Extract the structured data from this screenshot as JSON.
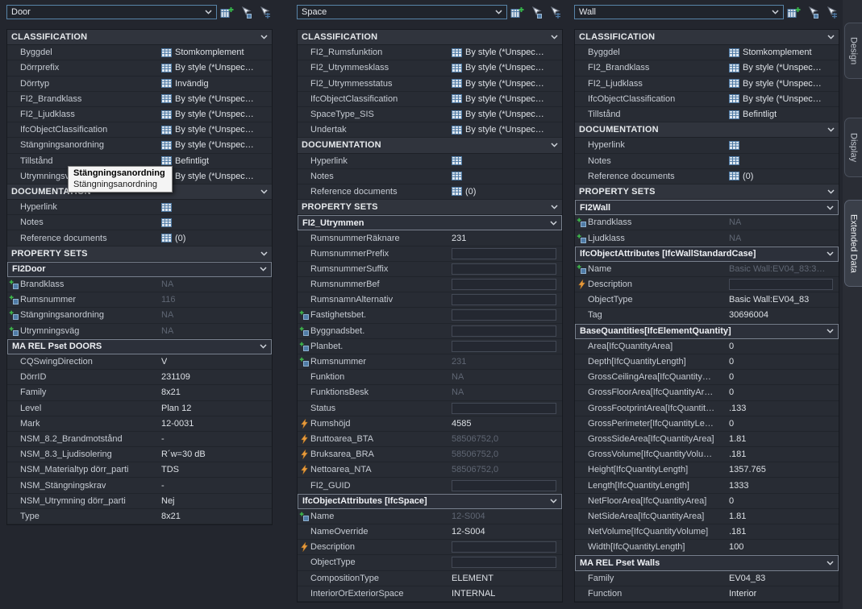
{
  "toolbar": {
    "icons": [
      "add-property-sets-icon",
      "quick-select-icon",
      "select-objects-icon"
    ]
  },
  "tooltip": {
    "title": "Stängningsanordning",
    "body": "Stängningsanordning"
  },
  "tabs": [
    {
      "label": "Design",
      "active": false
    },
    {
      "label": "Display",
      "active": false
    },
    {
      "label": "Extended Data",
      "active": true
    }
  ],
  "palettes": [
    {
      "selector": "Door",
      "blocks": [
        {
          "kind": "category",
          "title": "CLASSIFICATION",
          "rows": [
            {
              "label": "Byggdel",
              "value": "Stomkomplement",
              "value_icon": "table-icon"
            },
            {
              "label": "Dörrprefix",
              "value": "By style (*Unspec…",
              "value_icon": "table-icon"
            },
            {
              "label": "Dörrtyp",
              "value": "Invändig",
              "value_icon": "table-icon"
            },
            {
              "label": "FI2_Brandklass",
              "value": "By style (*Unspec…",
              "value_icon": "table-icon"
            },
            {
              "label": "FI2_Ljudklass",
              "value": "By style (*Unspec…",
              "value_icon": "table-icon"
            },
            {
              "label": "IfcObjectClassification",
              "value": "By style (*Unspec…",
              "value_icon": "table-icon"
            },
            {
              "label": "Stängningsanordning",
              "value": "By style (*Unspec…",
              "value_icon": "table-icon"
            },
            {
              "label": "Tillstånd",
              "value": "Befintligt",
              "value_icon": "table-icon"
            },
            {
              "label": "Utrymningsväg",
              "value": "By style (*Unspec…",
              "value_icon": "table-icon"
            }
          ]
        },
        {
          "kind": "category",
          "title": "DOCUMENTATION",
          "rows": [
            {
              "label": "Hyperlink",
              "value": "",
              "value_icon": "table-icon"
            },
            {
              "label": "Notes",
              "value": "",
              "value_icon": "table-icon"
            },
            {
              "label": "Reference documents",
              "value": "(0)",
              "value_icon": "table-icon"
            }
          ]
        },
        {
          "kind": "category",
          "title": "PROPERTY SETS",
          "rows": []
        },
        {
          "kind": "group",
          "title": "FI2Door",
          "rows": [
            {
              "label": "Brandklass",
              "value": "NA",
              "muted": true,
              "left_icon": "pset-add-icon"
            },
            {
              "label": "Rumsnummer",
              "value": "116",
              "muted": true,
              "left_icon": "pset-add-icon"
            },
            {
              "label": "Stängningsanordning",
              "value": "NA",
              "muted": true,
              "left_icon": "pset-add-icon"
            },
            {
              "label": "Utrymningsväg",
              "value": "NA",
              "muted": true,
              "left_icon": "pset-add-icon"
            }
          ]
        },
        {
          "kind": "group",
          "title": "MA REL Pset DOORS",
          "rows": [
            {
              "label": "CQSwingDirection",
              "value": "V"
            },
            {
              "label": "DörrID",
              "value": "231109"
            },
            {
              "label": "Family",
              "value": "8x21"
            },
            {
              "label": "Level",
              "value": "Plan 12"
            },
            {
              "label": "Mark",
              "value": "12-0031"
            },
            {
              "label": "NSM_8.2_Brandmotstånd",
              "value": "-"
            },
            {
              "label": "NSM_8.3_Ljudisolering",
              "value": "R´w=30 dB"
            },
            {
              "label": "NSM_Materialtyp dörr_parti",
              "value": "TDS"
            },
            {
              "label": "NSM_Stängningskrav",
              "value": "-"
            },
            {
              "label": "NSM_Utrymning dörr_parti",
              "value": "Nej"
            },
            {
              "label": "Type",
              "value": "8x21"
            }
          ]
        }
      ]
    },
    {
      "selector": "Space",
      "blocks": [
        {
          "kind": "category",
          "title": "CLASSIFICATION",
          "rows": [
            {
              "label": "FI2_Rumsfunktion",
              "value": "By style (*Unspec…",
              "value_icon": "table-icon"
            },
            {
              "label": "FI2_Utrymmesklass",
              "value": "By style (*Unspec…",
              "value_icon": "table-icon"
            },
            {
              "label": "FI2_Utrymmesstatus",
              "value": "By style (*Unspec…",
              "value_icon": "table-icon"
            },
            {
              "label": "IfcObjectClassification",
              "value": "By style (*Unspec…",
              "value_icon": "table-icon"
            },
            {
              "label": "SpaceType_SIS",
              "value": "By style (*Unspec…",
              "value_icon": "table-icon"
            },
            {
              "label": "Undertak",
              "value": "By style (*Unspec…",
              "value_icon": "table-icon"
            }
          ]
        },
        {
          "kind": "category",
          "title": "DOCUMENTATION",
          "rows": [
            {
              "label": "Hyperlink",
              "value": "",
              "value_icon": "table-icon"
            },
            {
              "label": "Notes",
              "value": "",
              "value_icon": "table-icon"
            },
            {
              "label": "Reference documents",
              "value": "(0)",
              "value_icon": "table-icon"
            }
          ]
        },
        {
          "kind": "category",
          "title": "PROPERTY SETS",
          "rows": []
        },
        {
          "kind": "group",
          "title": "FI2_Utrymmen",
          "rows": [
            {
              "label": "RumsnummerRäknare",
              "value": "231"
            },
            {
              "label": "RumsnummerPrefix",
              "field": true
            },
            {
              "label": "RumsnummerSuffix",
              "field": true
            },
            {
              "label": "RumsnummerBef",
              "field": true
            },
            {
              "label": "RumsnamnAlternativ",
              "field": true
            },
            {
              "label": "Fastighetsbet.",
              "field": true,
              "left_icon": "pset-add-icon"
            },
            {
              "label": "Byggnadsbet.",
              "field": true,
              "left_icon": "pset-add-icon"
            },
            {
              "label": "Planbet.",
              "field": true,
              "left_icon": "pset-add-icon"
            },
            {
              "label": "Rumsnummer",
              "value": "231",
              "muted": true,
              "left_icon": "pset-add-icon"
            },
            {
              "label": "Funktion",
              "value": "NA",
              "muted": true
            },
            {
              "label": "FunktionsBesk",
              "value": "NA",
              "muted": true
            },
            {
              "label": "Status",
              "field": true
            },
            {
              "label": "Rumshöjd",
              "value": "4585",
              "left_icon": "formula-icon"
            },
            {
              "label": "Bruttoarea_BTA",
              "value": "58506752,0",
              "muted": true,
              "left_icon": "formula-icon"
            },
            {
              "label": "Bruksarea_BRA",
              "value": "58506752,0",
              "muted": true,
              "left_icon": "formula-icon"
            },
            {
              "label": "Nettoarea_NTA",
              "value": "58506752,0",
              "muted": true,
              "left_icon": "formula-icon"
            },
            {
              "label": "FI2_GUID",
              "field": true
            }
          ]
        },
        {
          "kind": "group",
          "title": "IfcObjectAttributes [IfcSpace]",
          "rows": [
            {
              "label": "Name",
              "value": "12-S004",
              "muted": true,
              "left_icon": "pset-add-icon"
            },
            {
              "label": "NameOverride",
              "value": "12-S004"
            },
            {
              "label": "Description",
              "field": true,
              "left_icon": "formula-icon"
            },
            {
              "label": "ObjectType",
              "field": true
            },
            {
              "label": "CompositionType",
              "value": "ELEMENT"
            },
            {
              "label": "InteriorOrExteriorSpace",
              "value": "INTERNAL"
            }
          ]
        }
      ]
    },
    {
      "selector": "Wall",
      "blocks": [
        {
          "kind": "category",
          "title": "CLASSIFICATION",
          "rows": [
            {
              "label": "Byggdel",
              "value": "Stomkomplement",
              "value_icon": "table-icon"
            },
            {
              "label": "FI2_Brandklass",
              "value": "By style (*Unspec…",
              "value_icon": "table-icon"
            },
            {
              "label": "FI2_Ljudklass",
              "value": "By style (*Unspec…",
              "value_icon": "table-icon"
            },
            {
              "label": "IfcObjectClassification",
              "value": "By style (*Unspec…",
              "value_icon": "table-icon"
            },
            {
              "label": "Tillstånd",
              "value": "Befintligt",
              "value_icon": "table-icon"
            }
          ]
        },
        {
          "kind": "category",
          "title": "DOCUMENTATION",
          "rows": [
            {
              "label": "Hyperlink",
              "value": "",
              "value_icon": "table-icon"
            },
            {
              "label": "Notes",
              "value": "",
              "value_icon": "table-icon"
            },
            {
              "label": "Reference documents",
              "value": "(0)",
              "value_icon": "table-icon"
            }
          ]
        },
        {
          "kind": "category",
          "title": "PROPERTY SETS",
          "rows": []
        },
        {
          "kind": "group",
          "title": "FI2Wall",
          "rows": [
            {
              "label": "Brandklass",
              "value": "NA",
              "muted": true,
              "left_icon": "pset-add-icon"
            },
            {
              "label": "Ljudklass",
              "value": "NA",
              "muted": true,
              "left_icon": "pset-add-icon"
            }
          ]
        },
        {
          "kind": "group",
          "title": "IfcObjectAttributes [IfcWallStandardCase]",
          "rows": [
            {
              "label": "Name",
              "value": "Basic Wall:EV04_83:3…",
              "muted": true,
              "left_icon": "pset-add-icon"
            },
            {
              "label": "Description",
              "field": true,
              "left_icon": "formula-icon"
            },
            {
              "label": "ObjectType",
              "value": "Basic Wall:EV04_83"
            },
            {
              "label": "Tag",
              "value": "30696004"
            }
          ]
        },
        {
          "kind": "group",
          "title": "BaseQuantities[IfcElementQuantity]",
          "rows": [
            {
              "label": "Area[IfcQuantityArea]",
              "value": "0"
            },
            {
              "label": "Depth[IfcQuantityLength]",
              "value": "0"
            },
            {
              "label": "GrossCeilingArea[IfcQuantity…",
              "value": "0"
            },
            {
              "label": "GrossFloorArea[IfcQuantityAr…",
              "value": "0"
            },
            {
              "label": "GrossFootprintArea[IfcQuantit…",
              "value": ".133"
            },
            {
              "label": "GrossPerimeter[IfcQuantityLe…",
              "value": "0"
            },
            {
              "label": "GrossSideArea[IfcQuantityArea]",
              "value": "1.81"
            },
            {
              "label": "GrossVolume[IfcQuantityVolu…",
              "value": ".181"
            },
            {
              "label": "Height[IfcQuantityLength]",
              "value": "1357.765"
            },
            {
              "label": "Length[IfcQuantityLength]",
              "value": "1333"
            },
            {
              "label": "NetFloorArea[IfcQuantityArea]",
              "value": "0"
            },
            {
              "label": "NetSideArea[IfcQuantityArea]",
              "value": "1.81"
            },
            {
              "label": "NetVolume[IfcQuantityVolume]",
              "value": ".181"
            },
            {
              "label": "Width[IfcQuantityLength]",
              "value": "100"
            }
          ]
        },
        {
          "kind": "group",
          "title": "MA REL Pset Walls",
          "rows": [
            {
              "label": "Family",
              "value": "EV04_83"
            },
            {
              "label": "Function",
              "value": "Interior"
            }
          ]
        }
      ]
    }
  ]
}
